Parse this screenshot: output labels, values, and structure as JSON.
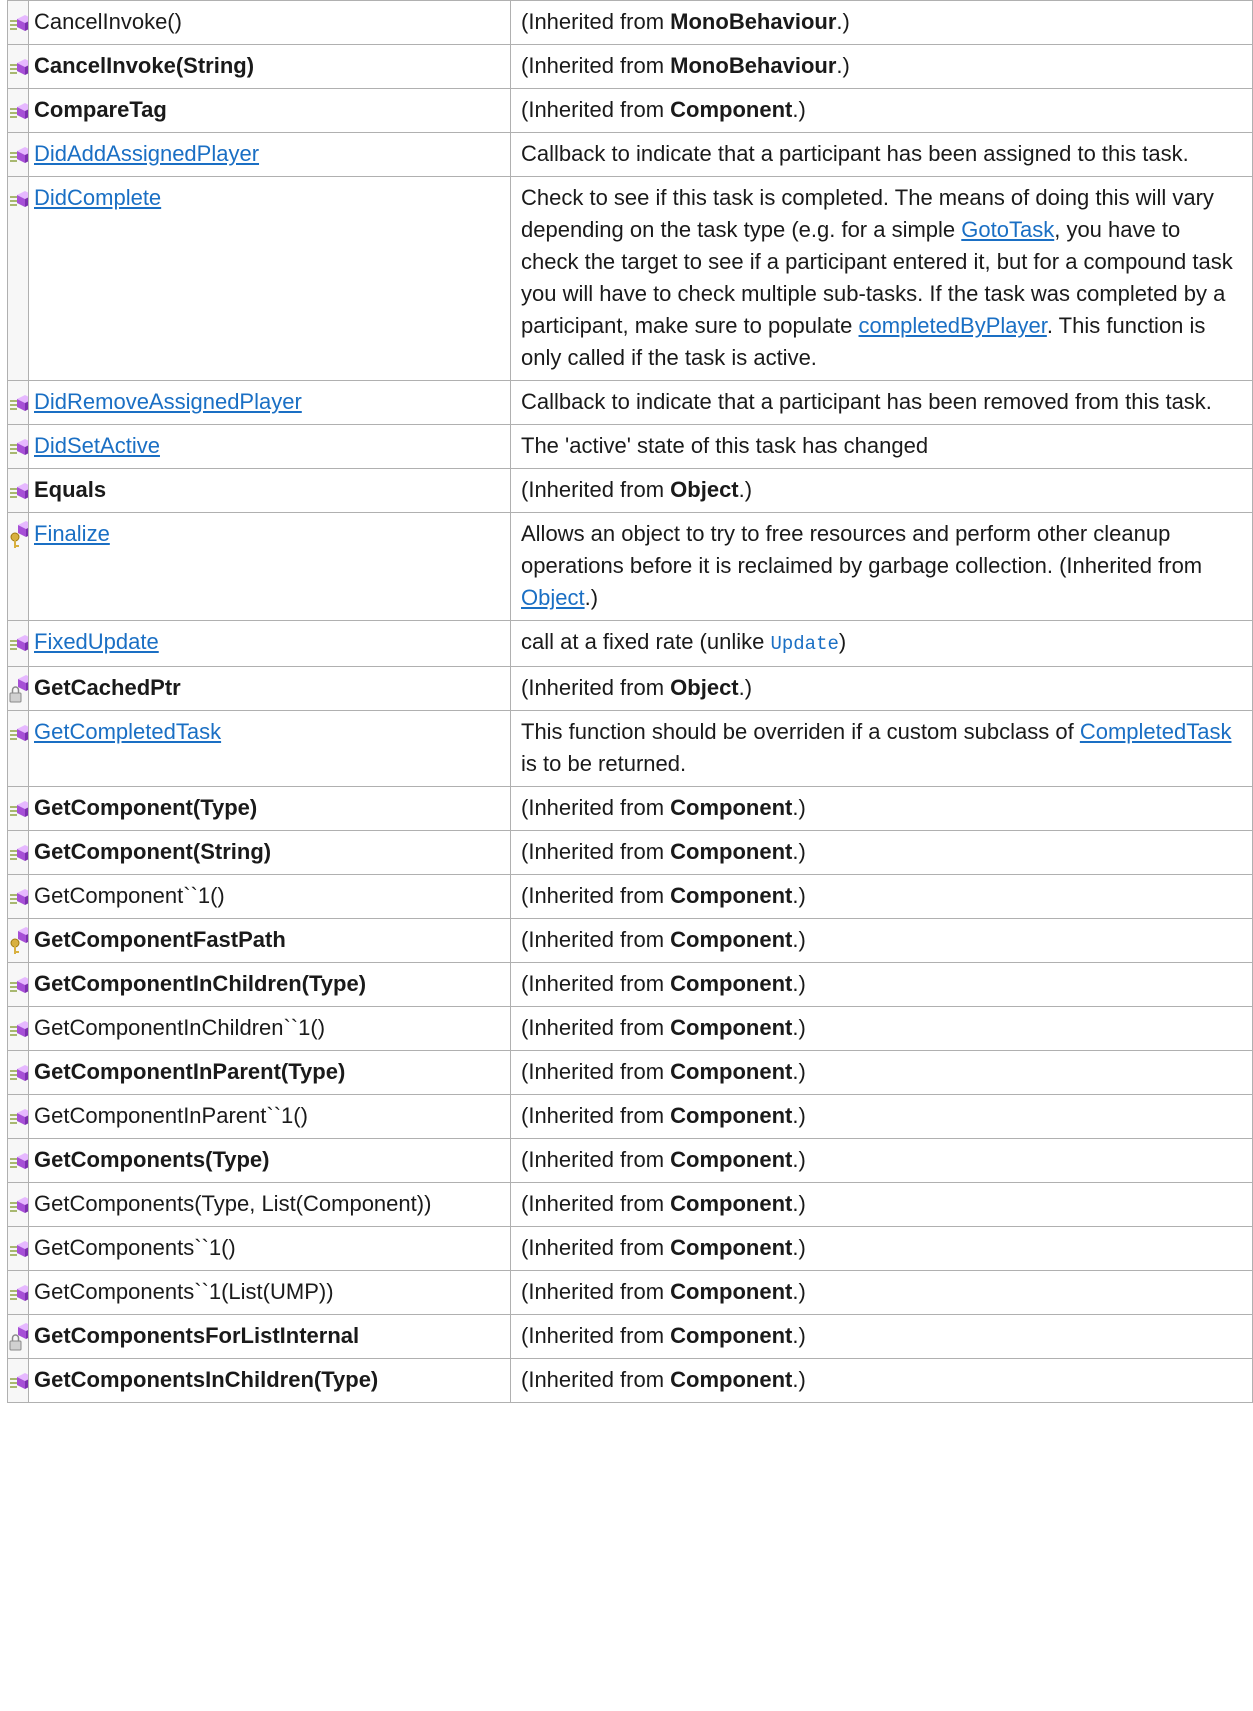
{
  "rows": [
    {
      "icon": "public-method-icon",
      "name": "CancelInvoke()",
      "name_style": "plain",
      "desc": [
        {
          "t": "(Inherited from "
        },
        {
          "t": "MonoBehaviour",
          "b": true
        },
        {
          "t": ".)"
        }
      ]
    },
    {
      "icon": "public-method-icon",
      "name": "CancelInvoke(String)",
      "name_style": "bold",
      "desc": [
        {
          "t": "(Inherited from "
        },
        {
          "t": "MonoBehaviour",
          "b": true
        },
        {
          "t": ".)"
        }
      ]
    },
    {
      "icon": "public-method-icon",
      "name": "CompareTag",
      "name_style": "bold",
      "desc": [
        {
          "t": "(Inherited from "
        },
        {
          "t": "Component",
          "b": true
        },
        {
          "t": ".)"
        }
      ]
    },
    {
      "icon": "public-method-icon",
      "name": "DidAddAssignedPlayer",
      "name_style": "link",
      "desc": [
        {
          "t": "Callback to indicate that a participant has been assigned to this task."
        }
      ]
    },
    {
      "icon": "public-method-icon",
      "name": "DidComplete",
      "name_style": "link",
      "desc": [
        {
          "t": "Check to see if this task is completed. The means of doing this will vary depending on the task type (e.g. for a simple "
        },
        {
          "t": "GotoTask",
          "link": true
        },
        {
          "t": ", you have to check the target to see if a participant entered it, but for a compound task you will have to check multiple sub-tasks. If the task was completed by a participant, make sure to populate "
        },
        {
          "t": "completedByPlayer",
          "link": true
        },
        {
          "t": ". This function is only called if the task is active."
        }
      ]
    },
    {
      "icon": "public-method-icon",
      "name": "DidRemoveAssignedPlayer",
      "name_style": "link",
      "desc": [
        {
          "t": "Callback to indicate that a participant has been removed from this task."
        }
      ]
    },
    {
      "icon": "public-method-icon",
      "name": "DidSetActive",
      "name_style": "link",
      "desc": [
        {
          "t": "The 'active' state of this task has changed"
        }
      ]
    },
    {
      "icon": "public-method-icon",
      "name": "Equals",
      "name_style": "bold",
      "desc": [
        {
          "t": "(Inherited from "
        },
        {
          "t": "Object",
          "b": true
        },
        {
          "t": ".)"
        }
      ]
    },
    {
      "icon": "protected-method-icon",
      "name": "Finalize",
      "name_style": "link",
      "desc": [
        {
          "t": "Allows an object to try to free resources and perform other cleanup operations before it is reclaimed by garbage collection. (Inherited from "
        },
        {
          "t": "Object",
          "link": true
        },
        {
          "t": ".)"
        }
      ]
    },
    {
      "icon": "public-method-icon",
      "name": "FixedUpdate",
      "name_style": "link",
      "desc": [
        {
          "t": "call at a fixed rate (unlike "
        },
        {
          "t": "Update",
          "code": true
        },
        {
          "t": ")"
        }
      ]
    },
    {
      "icon": "private-method-icon",
      "name": "GetCachedPtr",
      "name_style": "bold",
      "desc": [
        {
          "t": "(Inherited from "
        },
        {
          "t": "Object",
          "b": true
        },
        {
          "t": ".)"
        }
      ]
    },
    {
      "icon": "public-method-icon",
      "name": "GetCompletedTask",
      "name_style": "link",
      "desc": [
        {
          "t": "This function should be overriden if a custom subclass of "
        },
        {
          "t": "CompletedTask",
          "link": true
        },
        {
          "t": " is to be returned."
        }
      ]
    },
    {
      "icon": "public-method-icon",
      "name": "GetComponent(Type)",
      "name_style": "bold",
      "desc": [
        {
          "t": "(Inherited from "
        },
        {
          "t": "Component",
          "b": true
        },
        {
          "t": ".)"
        }
      ]
    },
    {
      "icon": "public-method-icon",
      "name": "GetComponent(String)",
      "name_style": "bold",
      "desc": [
        {
          "t": "(Inherited from "
        },
        {
          "t": "Component",
          "b": true
        },
        {
          "t": ".)"
        }
      ]
    },
    {
      "icon": "public-method-icon",
      "name": "GetComponent``1()",
      "name_style": "plain",
      "desc": [
        {
          "t": "(Inherited from "
        },
        {
          "t": "Component",
          "b": true
        },
        {
          "t": ".)"
        }
      ]
    },
    {
      "icon": "protected-method-icon",
      "name": "GetComponentFastPath",
      "name_style": "bold",
      "desc": [
        {
          "t": "(Inherited from "
        },
        {
          "t": "Component",
          "b": true
        },
        {
          "t": ".)"
        }
      ]
    },
    {
      "icon": "public-method-icon",
      "name": "GetComponentInChildren(Type)",
      "name_style": "bold",
      "desc": [
        {
          "t": "(Inherited from "
        },
        {
          "t": "Component",
          "b": true
        },
        {
          "t": ".)"
        }
      ]
    },
    {
      "icon": "public-method-icon",
      "name": "GetComponentInChildren``1()",
      "name_style": "plain",
      "desc": [
        {
          "t": "(Inherited from "
        },
        {
          "t": "Component",
          "b": true
        },
        {
          "t": ".)"
        }
      ]
    },
    {
      "icon": "public-method-icon",
      "name": "GetComponentInParent(Type)",
      "name_style": "bold",
      "desc": [
        {
          "t": "(Inherited from "
        },
        {
          "t": "Component",
          "b": true
        },
        {
          "t": ".)"
        }
      ]
    },
    {
      "icon": "public-method-icon",
      "name": "GetComponentInParent``1()",
      "name_style": "plain",
      "desc": [
        {
          "t": "(Inherited from "
        },
        {
          "t": "Component",
          "b": true
        },
        {
          "t": ".)"
        }
      ]
    },
    {
      "icon": "public-method-icon",
      "name": "GetComponents(Type)",
      "name_style": "bold",
      "desc": [
        {
          "t": "(Inherited from "
        },
        {
          "t": "Component",
          "b": true
        },
        {
          "t": ".)"
        }
      ]
    },
    {
      "icon": "public-method-icon",
      "name": "GetComponents(Type, List(Component))",
      "name_style": "plain",
      "desc": [
        {
          "t": "(Inherited from "
        },
        {
          "t": "Component",
          "b": true
        },
        {
          "t": ".)"
        }
      ]
    },
    {
      "icon": "public-method-icon",
      "name": "GetComponents``1()",
      "name_style": "plain",
      "desc": [
        {
          "t": "(Inherited from "
        },
        {
          "t": "Component",
          "b": true
        },
        {
          "t": ".)"
        }
      ]
    },
    {
      "icon": "public-method-icon",
      "name": "GetComponents``1(List(UMP))",
      "name_style": "plain",
      "desc": [
        {
          "t": "(Inherited from "
        },
        {
          "t": "Component",
          "b": true
        },
        {
          "t": ".)"
        }
      ]
    },
    {
      "icon": "private-method-icon",
      "name": "GetComponentsForListInternal",
      "name_style": "bold",
      "desc": [
        {
          "t": "(Inherited from "
        },
        {
          "t": "Component",
          "b": true
        },
        {
          "t": ".)"
        }
      ]
    },
    {
      "icon": "public-method-icon",
      "name": "GetComponentsInChildren(Type)",
      "name_style": "bold",
      "desc": [
        {
          "t": "(Inherited from "
        },
        {
          "t": "Component",
          "b": true
        },
        {
          "t": ".)"
        }
      ]
    }
  ],
  "colors": {
    "link": "#1a6fc4",
    "border": "#b0b0b0",
    "icon_purple": "#a64fd6",
    "icon_lines": "#a8b870",
    "icon_key": "#d8b040",
    "icon_lock": "#8a8a8a"
  }
}
